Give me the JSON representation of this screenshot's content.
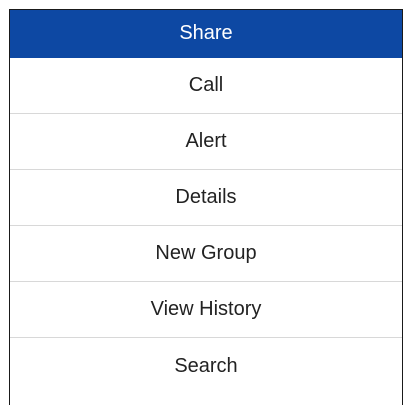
{
  "menu": {
    "items": [
      {
        "label": "Share"
      },
      {
        "label": "Call"
      },
      {
        "label": "Alert"
      },
      {
        "label": "Details"
      },
      {
        "label": "New Group"
      },
      {
        "label": "View History"
      },
      {
        "label": "Search"
      }
    ]
  },
  "colors": {
    "active_background": "#0d48a3",
    "active_text": "#ffffff",
    "text": "#222222",
    "divider": "#d8d8d8"
  }
}
